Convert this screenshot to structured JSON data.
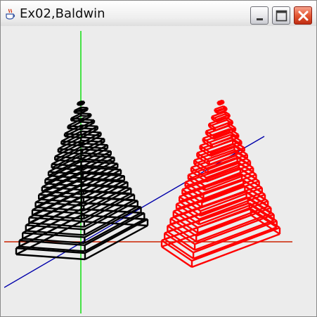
{
  "window": {
    "title": "Ex02,Baldwin",
    "icon": "java-cup-icon",
    "controls": [
      "minimize-icon",
      "maximize-icon",
      "close-icon"
    ]
  },
  "scene": {
    "axes": [
      {
        "name": "x",
        "color": "#cc2200"
      },
      {
        "name": "y",
        "color": "#00dd00"
      },
      {
        "name": "z",
        "color": "#0000aa"
      }
    ],
    "pyramids": [
      {
        "name": "left",
        "color": "#000000",
        "layers": 20
      },
      {
        "name": "right",
        "color": "#ff0000",
        "layers": 20
      }
    ]
  }
}
